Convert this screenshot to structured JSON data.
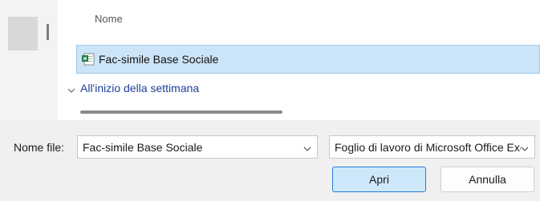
{
  "file_list": {
    "column_header": "Nome",
    "selected_file": {
      "name": "Fac-simile Base Sociale",
      "icon": "excel-file-icon"
    },
    "group_label": "All'inizio della settimana"
  },
  "footer": {
    "filename_label": "Nome file:",
    "filename_value": "Fac-simile Base Sociale",
    "filetype_value": "Foglio di lavoro di Microsoft Office Excel",
    "open_button": "Apri",
    "cancel_button": "Annulla"
  },
  "colors": {
    "selection_bg": "#cce4f7",
    "selection_border": "#99c9ef",
    "group_text": "#1f3f9c",
    "primary_button_border": "#2b79d6"
  }
}
